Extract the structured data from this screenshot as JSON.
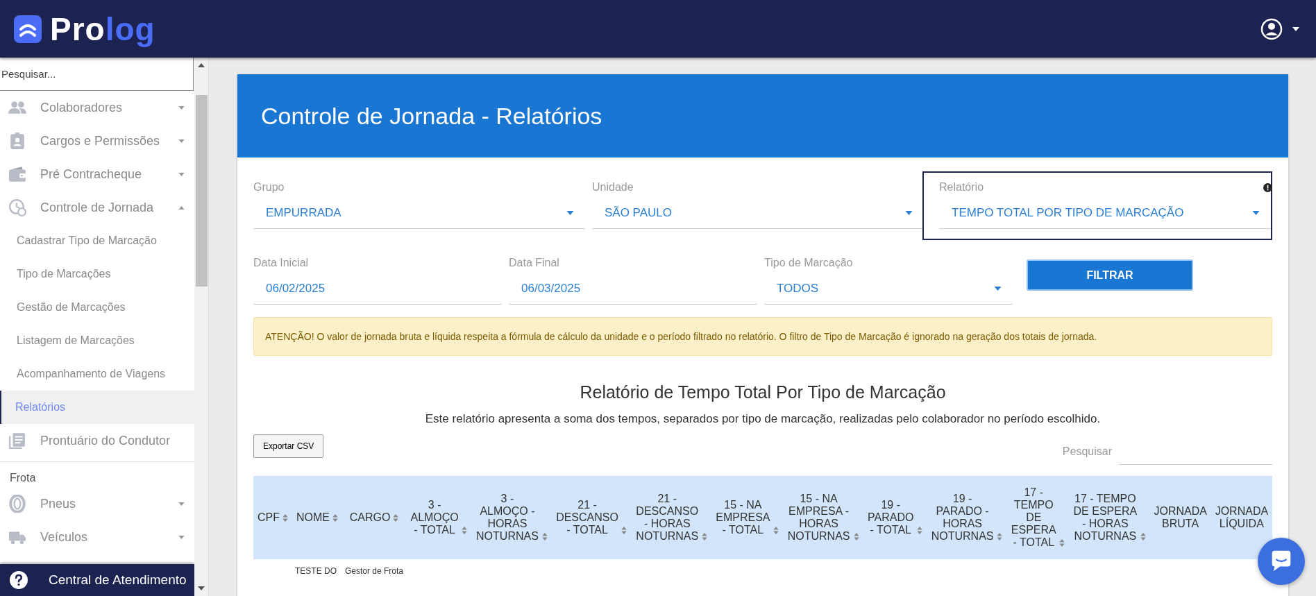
{
  "header": {
    "logo": {
      "part1": "Pro",
      "part2": "log"
    }
  },
  "sidebar": {
    "search": {
      "placeholder": "Pesquisar..."
    },
    "items": [
      {
        "kind": "group",
        "label": "Colaboradores",
        "expanded": false
      },
      {
        "kind": "group",
        "label": "Cargos e Permissões",
        "expanded": false
      },
      {
        "kind": "group",
        "label": "Pré Contracheque",
        "expanded": false
      },
      {
        "kind": "group",
        "label": "Controle de Jornada",
        "expanded": true,
        "children": [
          {
            "label": "Cadastrar Tipo de Marcação",
            "selected": false
          },
          {
            "label": "Tipo de Marcações",
            "selected": false
          },
          {
            "label": "Gestão de Marcações",
            "selected": false
          },
          {
            "label": "Listagem de Marcações",
            "selected": false
          },
          {
            "label": "Acompanhamento de Viagens",
            "selected": false
          },
          {
            "label": "Relatórios",
            "selected": true
          }
        ]
      },
      {
        "kind": "link",
        "label": "Prontuário do Condutor"
      },
      {
        "kind": "section",
        "label": "Frota"
      },
      {
        "kind": "group",
        "label": "Pneus",
        "expanded": false
      },
      {
        "kind": "group",
        "label": "Veículos",
        "expanded": false
      }
    ],
    "footer": {
      "label": "Central de Atendimento"
    }
  },
  "page": {
    "title": "Controle de Jornada - Relatórios",
    "filters_row1": [
      {
        "kind": "select",
        "label": "Grupo",
        "value": "EMPURRADA",
        "focused": false
      },
      {
        "kind": "select",
        "label": "Unidade",
        "value": "SÃO PAULO",
        "focused": false
      },
      {
        "kind": "select",
        "label": "Relatório",
        "value": "TEMPO TOTAL POR TIPO DE MARCAÇÃO",
        "focused": true
      }
    ],
    "filters_row2": [
      {
        "kind": "date",
        "label": "Data Inicial",
        "value": "06/02/2025"
      },
      {
        "kind": "date",
        "label": "Data Final",
        "value": "06/03/2025"
      },
      {
        "kind": "select",
        "label": "Tipo de Marcação",
        "value": "TODOS",
        "focused": false
      }
    ],
    "filter_button": "FILTRAR",
    "warning": "ATENÇÃO! O valor de jornada bruta e líquida respeita a fórmula de cálculo da unidade e o período filtrado no relatório. O filtro de Tipo de Marcação é ignorado na geração dos totais de jornada.",
    "report": {
      "title": "Relatório de Tempo Total Por Tipo de Marcação",
      "description": "Este relatório apresenta a soma dos tempos, separados por tipo de marcação, realizadas pelo colaborador no período escolhido.",
      "export_button": "Exportar CSV",
      "search_label": "Pesquisar",
      "table": {
        "columns": [
          {
            "label": "CPF",
            "sortable": true
          },
          {
            "label": "NOME",
            "sortable": true
          },
          {
            "label": "CARGO",
            "sortable": true
          },
          {
            "label": "3 - ALMOÇO - TOTAL",
            "sortable": true
          },
          {
            "label": "3 - ALMOÇO - HORAS NOTURNAS",
            "sortable": true
          },
          {
            "label": "21 - DESCANSO - TOTAL",
            "sortable": true
          },
          {
            "label": "21 - DESCANSO - HORAS NOTURNAS",
            "sortable": true
          },
          {
            "label": "15 - NA EMPRESA - TOTAL",
            "sortable": true
          },
          {
            "label": "15 - NA EMPRESA - HORAS NOTURNAS",
            "sortable": true
          },
          {
            "label": "19 - PARADO - TOTAL",
            "sortable": true
          },
          {
            "label": "19 - PARADO - HORAS NOTURNAS",
            "sortable": true
          },
          {
            "label": "17 - TEMPO DE ESPERA - TOTAL",
            "sortable": true
          },
          {
            "label": "17 - TEMPO DE ESPERA - HORAS NOTURNAS",
            "sortable": true
          },
          {
            "label": "JORNADA BRUTA",
            "sortable": false
          },
          {
            "label": "JORNADA LÍQUIDA",
            "sortable": false
          }
        ],
        "rows": [
          {
            "cells": [
              "",
              "TESTE DO",
              "Gestor de Frota"
            ]
          }
        ]
      }
    }
  }
}
